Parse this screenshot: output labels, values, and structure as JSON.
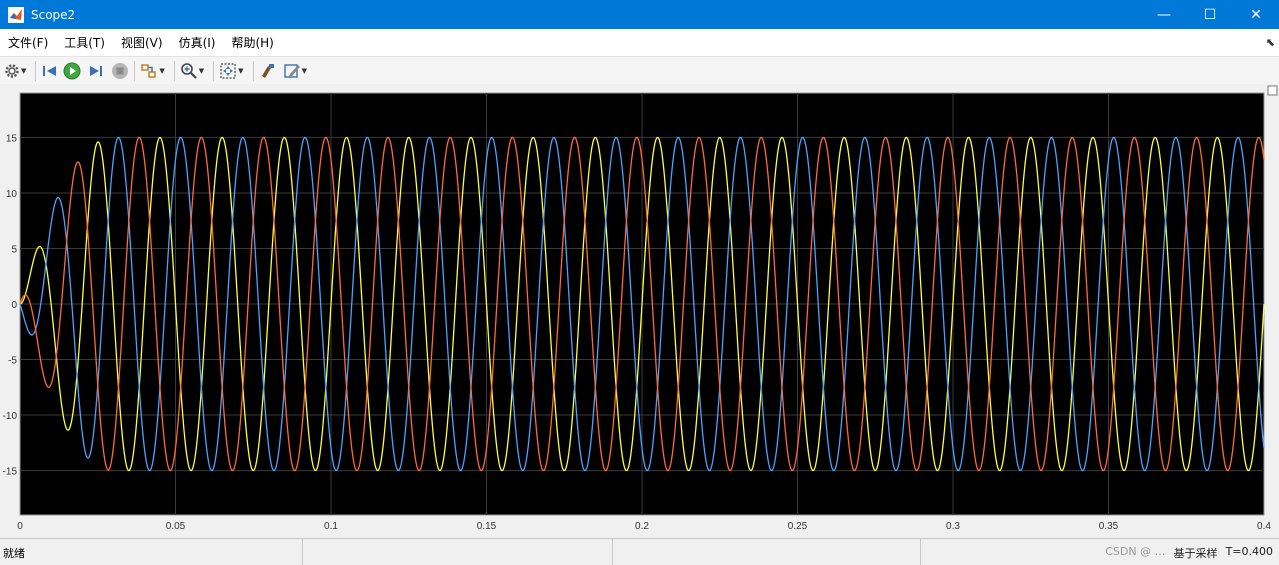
{
  "window": {
    "title": "Scope2",
    "controls": {
      "minimize": "—",
      "maximize": "☐",
      "close": "✕"
    }
  },
  "menu": {
    "items": [
      "文件(F)",
      "工具(T)",
      "视图(V)",
      "仿真(I)",
      "帮助(H)"
    ]
  },
  "toolbar": {
    "icons": [
      "gear-icon",
      "step-back-icon",
      "run-icon",
      "step-forward-icon",
      "stop-icon",
      "signal-select-icon",
      "zoom-icon",
      "fit-view-icon",
      "style-icon",
      "edit-icon"
    ]
  },
  "status": {
    "left": "就绪",
    "mode": "基于采样",
    "time": "T=0.400",
    "watermark": "CSDN @ …"
  },
  "colors": {
    "plot_bg": "#000000",
    "grid": "#3a3a3a",
    "axis_text": "#f0f0f0"
  },
  "chart_data": {
    "type": "line",
    "title": "",
    "xlabel": "",
    "ylabel": "",
    "xlim": [
      0,
      0.4
    ],
    "ylim": [
      -19,
      19
    ],
    "x_ticks": [
      0,
      0.05,
      0.1,
      0.15,
      0.2,
      0.25,
      0.3,
      0.35,
      0.4
    ],
    "x_tick_labels": [
      "0",
      "0.05",
      "0.1",
      "0.15",
      "0.2",
      "0.25",
      "0.3",
      "0.35",
      "0.4"
    ],
    "y_ticks": [
      15,
      10,
      5,
      0,
      -5,
      -10,
      -15
    ],
    "y_tick_labels": [
      "15",
      "10",
      "5",
      "0",
      "-5",
      "-10",
      "-15"
    ],
    "grid": true,
    "legend": "none",
    "signal": {
      "amplitude": 15,
      "frequency_hz": 50,
      "ramp_time_s": 0.03
    },
    "series": [
      {
        "color": "#ffff40",
        "phase_deg": 0
      },
      {
        "color": "#4aa3ff",
        "phase_deg": -120
      },
      {
        "color": "#ff6a3a",
        "phase_deg": 120
      }
    ]
  }
}
